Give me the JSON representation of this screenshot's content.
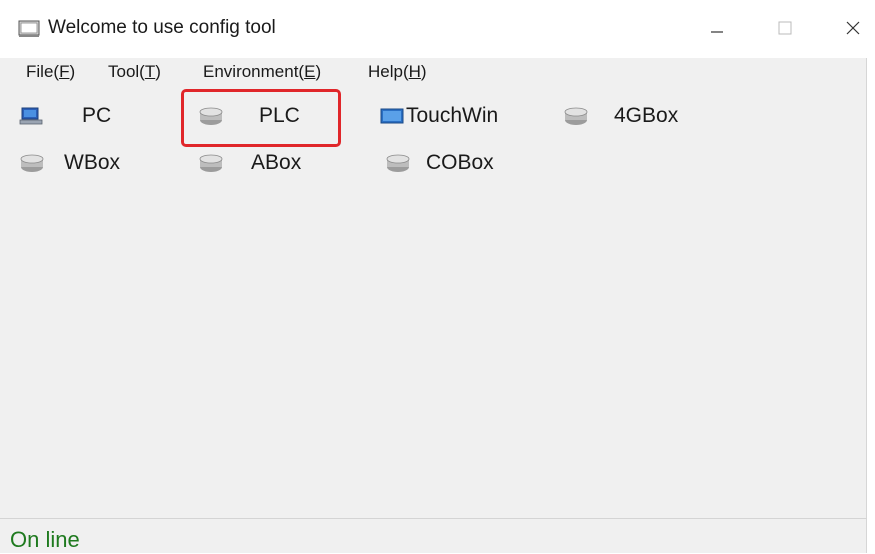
{
  "window": {
    "title": "Welcome to use  config tool",
    "controls": {
      "minimize": "minimize-icon",
      "maximize": "maximize-icon",
      "close": "close-icon"
    }
  },
  "menu": {
    "file": {
      "label": "File(",
      "key": "F",
      "end": ")"
    },
    "tool": {
      "label": "Tool(",
      "key": "T",
      "end": ")"
    },
    "environment": {
      "label": "Environment(",
      "key": "E",
      "end": ")"
    },
    "help": {
      "label": "Help(",
      "key": "H",
      "end": ")"
    }
  },
  "devices": [
    {
      "label": "PC",
      "icon": "pc-icon"
    },
    {
      "label": "PLC",
      "icon": "plc-icon"
    },
    {
      "label": "TouchWin",
      "icon": "touchwin-icon"
    },
    {
      "label": "4GBox",
      "icon": "4gbox-icon"
    },
    {
      "label": "WBox",
      "icon": "wbox-icon"
    },
    {
      "label": "ABox",
      "icon": "abox-icon"
    },
    {
      "label": "COBox",
      "icon": "cobox-icon"
    }
  ],
  "status": {
    "text": "On line"
  },
  "colors": {
    "highlight": "#e0262a",
    "status_text": "#1f7a1f",
    "background": "#f0f0f0"
  }
}
